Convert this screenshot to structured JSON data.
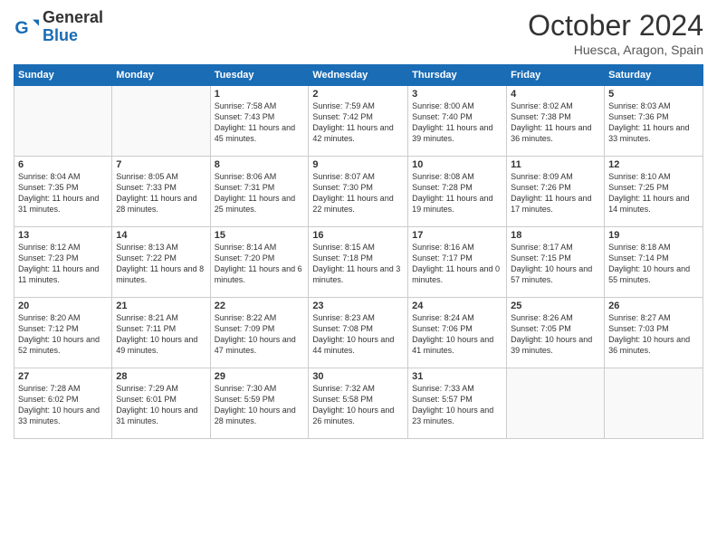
{
  "header": {
    "logo_general": "General",
    "logo_blue": "Blue",
    "month_title": "October 2024",
    "location": "Huesca, Aragon, Spain"
  },
  "days_of_week": [
    "Sunday",
    "Monday",
    "Tuesday",
    "Wednesday",
    "Thursday",
    "Friday",
    "Saturday"
  ],
  "weeks": [
    [
      {
        "day": "",
        "info": ""
      },
      {
        "day": "",
        "info": ""
      },
      {
        "day": "1",
        "info": "Sunrise: 7:58 AM\nSunset: 7:43 PM\nDaylight: 11 hours and 45 minutes."
      },
      {
        "day": "2",
        "info": "Sunrise: 7:59 AM\nSunset: 7:42 PM\nDaylight: 11 hours and 42 minutes."
      },
      {
        "day": "3",
        "info": "Sunrise: 8:00 AM\nSunset: 7:40 PM\nDaylight: 11 hours and 39 minutes."
      },
      {
        "day": "4",
        "info": "Sunrise: 8:02 AM\nSunset: 7:38 PM\nDaylight: 11 hours and 36 minutes."
      },
      {
        "day": "5",
        "info": "Sunrise: 8:03 AM\nSunset: 7:36 PM\nDaylight: 11 hours and 33 minutes."
      }
    ],
    [
      {
        "day": "6",
        "info": "Sunrise: 8:04 AM\nSunset: 7:35 PM\nDaylight: 11 hours and 31 minutes."
      },
      {
        "day": "7",
        "info": "Sunrise: 8:05 AM\nSunset: 7:33 PM\nDaylight: 11 hours and 28 minutes."
      },
      {
        "day": "8",
        "info": "Sunrise: 8:06 AM\nSunset: 7:31 PM\nDaylight: 11 hours and 25 minutes."
      },
      {
        "day": "9",
        "info": "Sunrise: 8:07 AM\nSunset: 7:30 PM\nDaylight: 11 hours and 22 minutes."
      },
      {
        "day": "10",
        "info": "Sunrise: 8:08 AM\nSunset: 7:28 PM\nDaylight: 11 hours and 19 minutes."
      },
      {
        "day": "11",
        "info": "Sunrise: 8:09 AM\nSunset: 7:26 PM\nDaylight: 11 hours and 17 minutes."
      },
      {
        "day": "12",
        "info": "Sunrise: 8:10 AM\nSunset: 7:25 PM\nDaylight: 11 hours and 14 minutes."
      }
    ],
    [
      {
        "day": "13",
        "info": "Sunrise: 8:12 AM\nSunset: 7:23 PM\nDaylight: 11 hours and 11 minutes."
      },
      {
        "day": "14",
        "info": "Sunrise: 8:13 AM\nSunset: 7:22 PM\nDaylight: 11 hours and 8 minutes."
      },
      {
        "day": "15",
        "info": "Sunrise: 8:14 AM\nSunset: 7:20 PM\nDaylight: 11 hours and 6 minutes."
      },
      {
        "day": "16",
        "info": "Sunrise: 8:15 AM\nSunset: 7:18 PM\nDaylight: 11 hours and 3 minutes."
      },
      {
        "day": "17",
        "info": "Sunrise: 8:16 AM\nSunset: 7:17 PM\nDaylight: 11 hours and 0 minutes."
      },
      {
        "day": "18",
        "info": "Sunrise: 8:17 AM\nSunset: 7:15 PM\nDaylight: 10 hours and 57 minutes."
      },
      {
        "day": "19",
        "info": "Sunrise: 8:18 AM\nSunset: 7:14 PM\nDaylight: 10 hours and 55 minutes."
      }
    ],
    [
      {
        "day": "20",
        "info": "Sunrise: 8:20 AM\nSunset: 7:12 PM\nDaylight: 10 hours and 52 minutes."
      },
      {
        "day": "21",
        "info": "Sunrise: 8:21 AM\nSunset: 7:11 PM\nDaylight: 10 hours and 49 minutes."
      },
      {
        "day": "22",
        "info": "Sunrise: 8:22 AM\nSunset: 7:09 PM\nDaylight: 10 hours and 47 minutes."
      },
      {
        "day": "23",
        "info": "Sunrise: 8:23 AM\nSunset: 7:08 PM\nDaylight: 10 hours and 44 minutes."
      },
      {
        "day": "24",
        "info": "Sunrise: 8:24 AM\nSunset: 7:06 PM\nDaylight: 10 hours and 41 minutes."
      },
      {
        "day": "25",
        "info": "Sunrise: 8:26 AM\nSunset: 7:05 PM\nDaylight: 10 hours and 39 minutes."
      },
      {
        "day": "26",
        "info": "Sunrise: 8:27 AM\nSunset: 7:03 PM\nDaylight: 10 hours and 36 minutes."
      }
    ],
    [
      {
        "day": "27",
        "info": "Sunrise: 7:28 AM\nSunset: 6:02 PM\nDaylight: 10 hours and 33 minutes."
      },
      {
        "day": "28",
        "info": "Sunrise: 7:29 AM\nSunset: 6:01 PM\nDaylight: 10 hours and 31 minutes."
      },
      {
        "day": "29",
        "info": "Sunrise: 7:30 AM\nSunset: 5:59 PM\nDaylight: 10 hours and 28 minutes."
      },
      {
        "day": "30",
        "info": "Sunrise: 7:32 AM\nSunset: 5:58 PM\nDaylight: 10 hours and 26 minutes."
      },
      {
        "day": "31",
        "info": "Sunrise: 7:33 AM\nSunset: 5:57 PM\nDaylight: 10 hours and 23 minutes."
      },
      {
        "day": "",
        "info": ""
      },
      {
        "day": "",
        "info": ""
      }
    ]
  ]
}
